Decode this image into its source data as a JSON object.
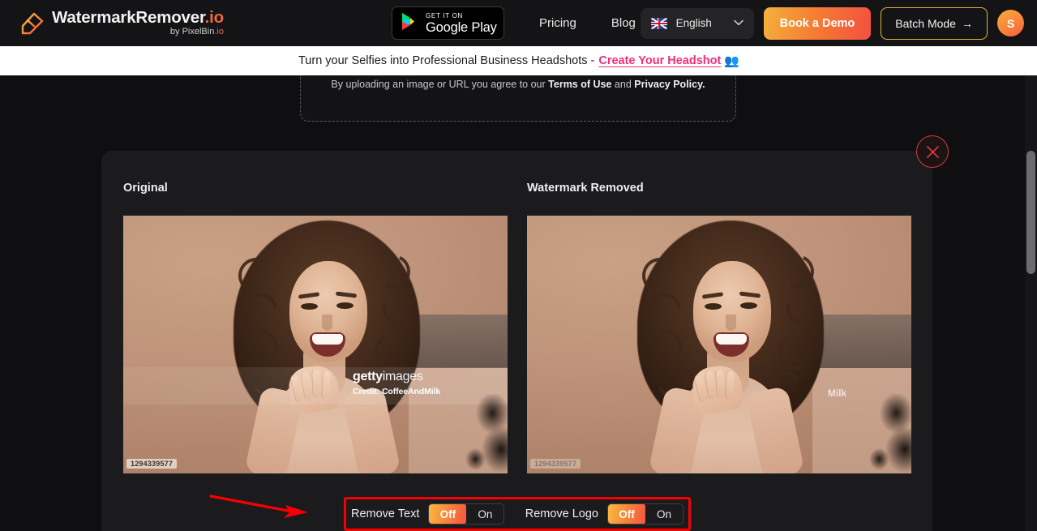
{
  "header": {
    "brand_title": "WatermarkRemover",
    "brand_title_domain": ".io",
    "brand_sub_prefix": "by PixelBin",
    "brand_sub_domain": ".io",
    "brand_logo_icon": "eraser-logo-icon",
    "google_play": {
      "top": "GET IT ON",
      "bottom": "Google Play",
      "icon": "google-play-triangle-icon"
    },
    "nav": [
      {
        "label": "Pricing",
        "name": "nav-link-pricing"
      },
      {
        "label": "Blog",
        "name": "nav-link-blog"
      }
    ],
    "language": {
      "label": "English",
      "flag_icon": "uk-flag-icon",
      "chevron_icon": "chevron-down-icon"
    },
    "demo_button": "Book a Demo",
    "batch_button": "Batch Mode",
    "batch_arrow": "→",
    "avatar_initial": "S"
  },
  "promo": {
    "text": "Turn your Selfies into Professional Business Headshots -",
    "link": "Create Your Headshot",
    "emoji": "👥"
  },
  "upload": {
    "terms_prefix": "By uploading an image or URL you agree to our",
    "terms_link": "Terms of Use",
    "terms_and": "and",
    "privacy_link": "Privacy Policy."
  },
  "result": {
    "close_icon": "close-icon",
    "left_title": "Original",
    "right_title": "Watermark Removed",
    "watermark": {
      "brand_bold": "getty",
      "brand_light": "images",
      "credit": "Credit: CoffeeAndMilk",
      "residual": "Milk"
    },
    "image_id": "1294339577"
  },
  "toggles": [
    {
      "name": "remove-text-toggle",
      "label": "Remove Text",
      "options": [
        "Off",
        "On"
      ],
      "selected": "Off"
    },
    {
      "name": "remove-logo-toggle",
      "label": "Remove Logo",
      "options": [
        "Off",
        "On"
      ],
      "selected": "Off"
    }
  ],
  "annotations": {
    "arrow_color": "#f50000",
    "highlight_box_color": "#f50000"
  },
  "colors": {
    "page_bg": "#0f0f11",
    "header_bg": "#141416",
    "panel_bg": "#1b1b1e",
    "accent_gradient_start": "#fbb93f",
    "accent_gradient_end": "#f5543f",
    "promo_link": "#ee2e7b",
    "batch_border": "#e0b53a"
  }
}
